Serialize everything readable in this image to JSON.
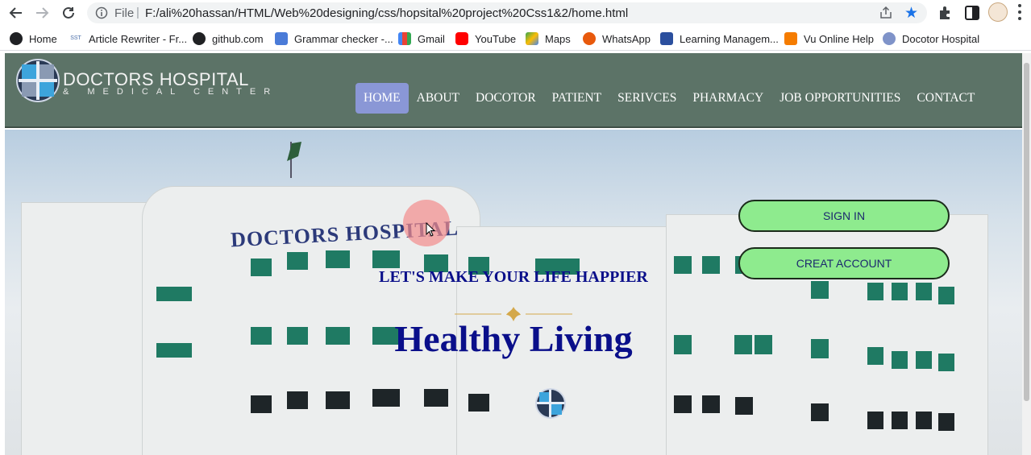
{
  "browser": {
    "file_label": "File",
    "separator": "|",
    "url": "F:/ali%20hassan/HTML/Web%20designing/css/hopsital%20project%20Css1&2/home.html"
  },
  "bookmarks": [
    {
      "label": "Home",
      "icon": "home-icon",
      "color": "#202124"
    },
    {
      "label": "Article Rewriter - Fr...",
      "icon": "sst-icon",
      "color": "#4a6ea9"
    },
    {
      "label": "github.com",
      "icon": "github-icon",
      "color": "#202124"
    },
    {
      "label": "Grammar checker -...",
      "icon": "grammar-icon",
      "color": "#4a7bd8"
    },
    {
      "label": "Gmail",
      "icon": "gmail-icon",
      "color": "#ea4335"
    },
    {
      "label": "YouTube",
      "icon": "youtube-icon",
      "color": "#ff0000"
    },
    {
      "label": "Maps",
      "icon": "maps-icon",
      "color": "#34a853"
    },
    {
      "label": "WhatsApp",
      "icon": "whatsapp-icon",
      "color": "#e8590c"
    },
    {
      "label": "Learning Managem...",
      "icon": "lms-icon",
      "color": "#2b4f9e"
    },
    {
      "label": "Vu Online Help",
      "icon": "blogger-icon",
      "color": "#f57c00"
    },
    {
      "label": "Docotor Hospital",
      "icon": "hospital-icon",
      "color": "#7f93c9"
    }
  ],
  "site": {
    "logo_title": "DOCTORS HOSPITAL",
    "logo_subtitle": "& MEDICAL CENTER",
    "nav": [
      {
        "label": "HOME",
        "active": true
      },
      {
        "label": "ABOUT",
        "active": false
      },
      {
        "label": "DOCOTOR",
        "active": false
      },
      {
        "label": "PATIENT",
        "active": false
      },
      {
        "label": "SERIVCES",
        "active": false
      },
      {
        "label": "PHARMACY",
        "active": false
      },
      {
        "label": "JOB OPPORTUNITIES",
        "active": false
      },
      {
        "label": "CONTACT",
        "active": false
      }
    ],
    "hero": {
      "building_sign": "DOCTORS HOSPITAL",
      "tagline": "LET'S MAKE YOUR LIFE HAPPIER",
      "headline": "Healthy Living",
      "sign_in": "SIGN IN",
      "create_account": "CREAT ACCOUNT"
    }
  },
  "colors": {
    "header_bg": "#5c7367",
    "nav_active": "#8a97d6",
    "button_bg": "#8eeb8e",
    "heading_blue": "#0a0f8a"
  }
}
